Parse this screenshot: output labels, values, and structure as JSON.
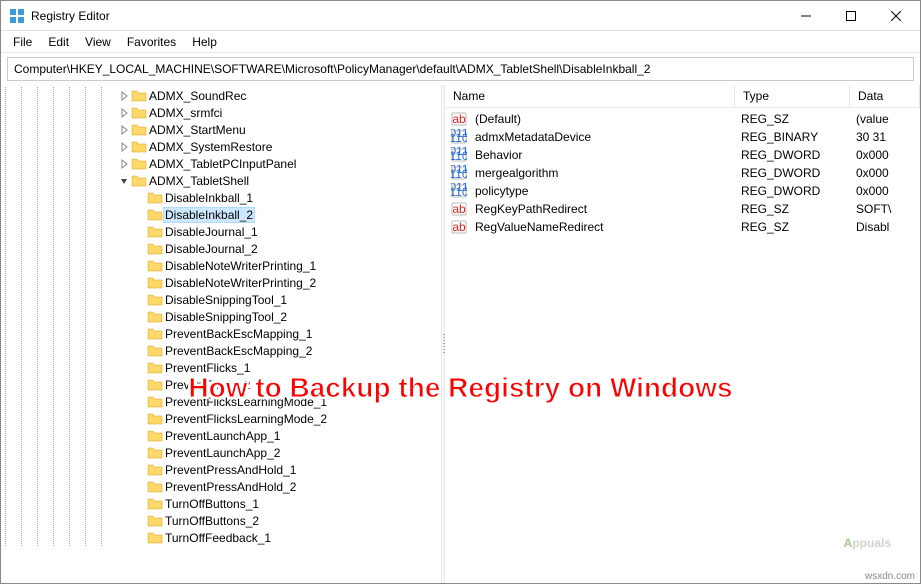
{
  "window": {
    "title": "Registry Editor"
  },
  "menu": {
    "file": "File",
    "edit": "Edit",
    "view": "View",
    "favorites": "Favorites",
    "help": "Help"
  },
  "address": "Computer\\HKEY_LOCAL_MACHINE\\SOFTWARE\\Microsoft\\PolicyManager\\default\\ADMX_TabletShell\\DisableInkball_2",
  "tree": {
    "ancestors_depth": 7,
    "siblings": [
      {
        "label": "ADMX_SoundRec",
        "expand": "closed"
      },
      {
        "label": "ADMX_srmfci",
        "expand": "closed"
      },
      {
        "label": "ADMX_StartMenu",
        "expand": "closed"
      },
      {
        "label": "ADMX_SystemRestore",
        "expand": "closed"
      },
      {
        "label": "ADMX_TabletPCInputPanel",
        "expand": "closed"
      },
      {
        "label": "ADMX_TabletShell",
        "expand": "open",
        "children": [
          {
            "label": "DisableInkball_1"
          },
          {
            "label": "DisableInkball_2",
            "selected": true
          },
          {
            "label": "DisableJournal_1"
          },
          {
            "label": "DisableJournal_2"
          },
          {
            "label": "DisableNoteWriterPrinting_1"
          },
          {
            "label": "DisableNoteWriterPrinting_2"
          },
          {
            "label": "DisableSnippingTool_1"
          },
          {
            "label": "DisableSnippingTool_2"
          },
          {
            "label": "PreventBackEscMapping_1"
          },
          {
            "label": "PreventBackEscMapping_2"
          },
          {
            "label": "PreventFlicks_1"
          },
          {
            "label": "PreventFlicks_2"
          },
          {
            "label": "PreventFlicksLearningMode_1"
          },
          {
            "label": "PreventFlicksLearningMode_2"
          },
          {
            "label": "PreventLaunchApp_1"
          },
          {
            "label": "PreventLaunchApp_2"
          },
          {
            "label": "PreventPressAndHold_1"
          },
          {
            "label": "PreventPressAndHold_2"
          },
          {
            "label": "TurnOffButtons_1"
          },
          {
            "label": "TurnOffButtons_2"
          },
          {
            "label": "TurnOffFeedback_1"
          }
        ]
      }
    ]
  },
  "list": {
    "columns": {
      "name": "Name",
      "type": "Type",
      "data": "Data"
    },
    "rows": [
      {
        "icon": "string",
        "name": "(Default)",
        "type": "REG_SZ",
        "data": "(value"
      },
      {
        "icon": "binary",
        "name": "admxMetadataDevice",
        "type": "REG_BINARY",
        "data": "30 31"
      },
      {
        "icon": "binary",
        "name": "Behavior",
        "type": "REG_DWORD",
        "data": "0x000"
      },
      {
        "icon": "binary",
        "name": "mergealgorithm",
        "type": "REG_DWORD",
        "data": "0x000"
      },
      {
        "icon": "binary",
        "name": "policytype",
        "type": "REG_DWORD",
        "data": "0x000"
      },
      {
        "icon": "string",
        "name": "RegKeyPathRedirect",
        "type": "REG_SZ",
        "data": "SOFT\\"
      },
      {
        "icon": "string",
        "name": "RegValueNameRedirect",
        "type": "REG_SZ",
        "data": "Disabl"
      }
    ]
  },
  "overlay": {
    "title": "How to Backup the Registry on Windows",
    "watermark_prefix": "A",
    "watermark_rest": "ppuals",
    "source": "wsxdn.com"
  }
}
